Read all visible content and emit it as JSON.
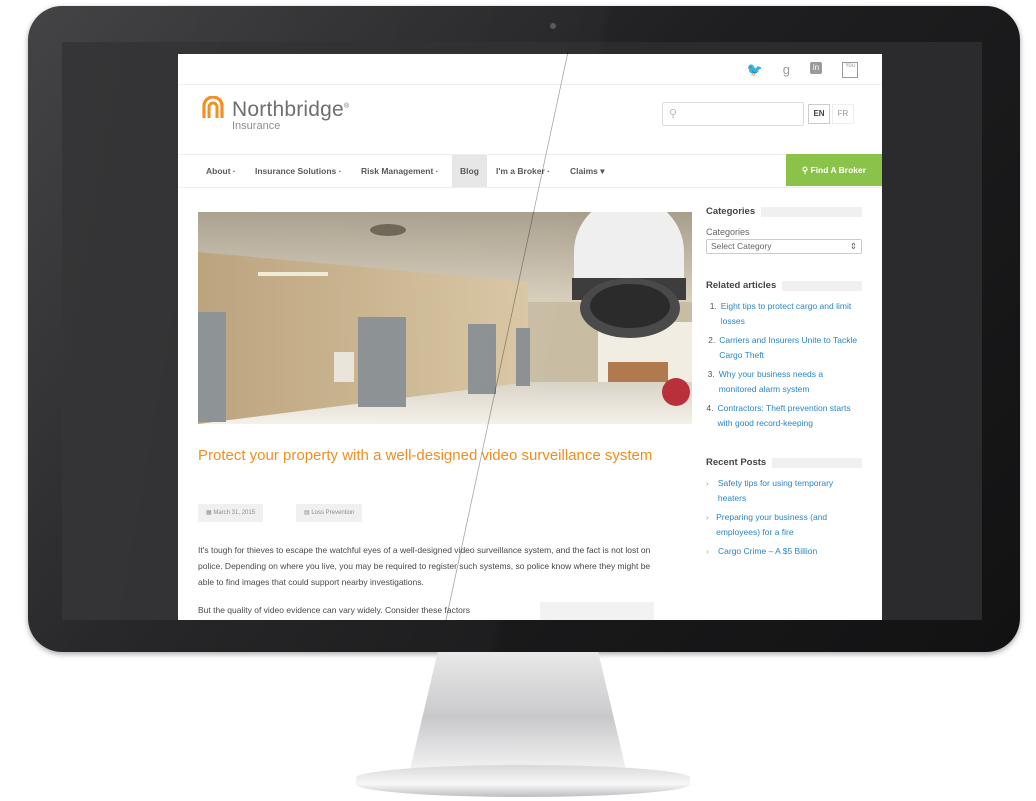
{
  "social": {
    "icons": [
      "twitter-icon",
      "google-plus-icon",
      "linkedin-icon",
      "youtube-icon"
    ],
    "youtube_label": "You"
  },
  "header": {
    "logo_name": "Northbridge",
    "logo_sub": "Insurance",
    "logo_reg": "®",
    "lang_en": "EN",
    "lang_fr": "FR"
  },
  "nav": {
    "items": [
      "About ·",
      "Insurance Solutions ·",
      "Risk Management ·",
      "Blog",
      "I'm a Broker ·",
      "Claims ▾"
    ],
    "find_broker": "Find A Broker"
  },
  "article": {
    "title": "Protect your property with a well-designed video surveillance system",
    "date": "March 31, 2015",
    "category": "Loss Prevention",
    "para1": "It's tough for thieves to escape the watchful eyes of a well-designed video surveillance system, and the fact is not lost on police. Depending on where you live, you may be required to register such systems, so police know where they might be able to find images that could support nearby investigations.",
    "para2": "But the quality of video evidence can vary widely. Consider these factors"
  },
  "sidebar": {
    "categories_heading": "Categories",
    "categories_label": "Categories",
    "select_value": "Select Category",
    "related_heading": "Related articles",
    "related": [
      {
        "num": "1.",
        "title": "Eight tips to protect cargo and limit losses"
      },
      {
        "num": "2.",
        "title": "Carriers and Insurers Unite to Tackle Cargo Theft"
      },
      {
        "num": "3.",
        "title": "Why your business needs a monitored alarm system"
      },
      {
        "num": "4.",
        "title": "Contractors: Theft prevention starts with good record-keeping"
      }
    ],
    "recent_heading": "Recent Posts",
    "recent": [
      {
        "title": "Safety tips for using temporary heaters"
      },
      {
        "title": "Preparing your business (and employees) for a fire"
      },
      {
        "title": "Cargo Crime – A $5 Billion"
      }
    ]
  },
  "colors": {
    "accent_orange": "#f08c1a",
    "link_blue": "#2b86c5",
    "broker_green": "#8bc34a"
  }
}
